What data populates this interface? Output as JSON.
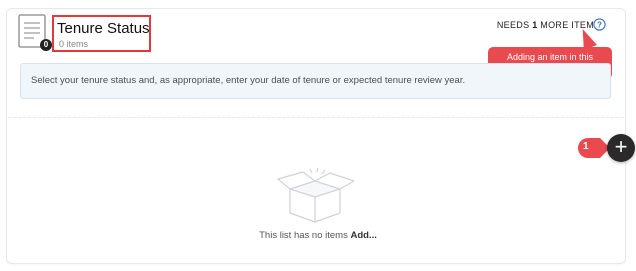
{
  "section": {
    "title": "Tenure Status",
    "item_count_label": "0 items",
    "badge_count": "0",
    "needs_prefix": "NEEDS ",
    "needs_count": "1",
    "needs_suffix": " MORE ITEM",
    "instruction": "Select your tenure status and, as appropriate, enter your date of tenure or expected tenure review year."
  },
  "tooltip": {
    "text": "Adding an item in this section is required"
  },
  "step_marker": {
    "number": "1"
  },
  "add_button": {
    "glyph": "+"
  },
  "empty_state": {
    "message": "This list has no items ",
    "add_label": "Add..."
  },
  "colors": {
    "annotation_red": "#e84a4f",
    "title_outline": "#e0393e",
    "info_bg": "#f1f6fb",
    "fab": "#2a2a2a"
  },
  "icons": {
    "document": "document-icon",
    "help": "question-circle-icon",
    "empty": "open-box-icon"
  }
}
